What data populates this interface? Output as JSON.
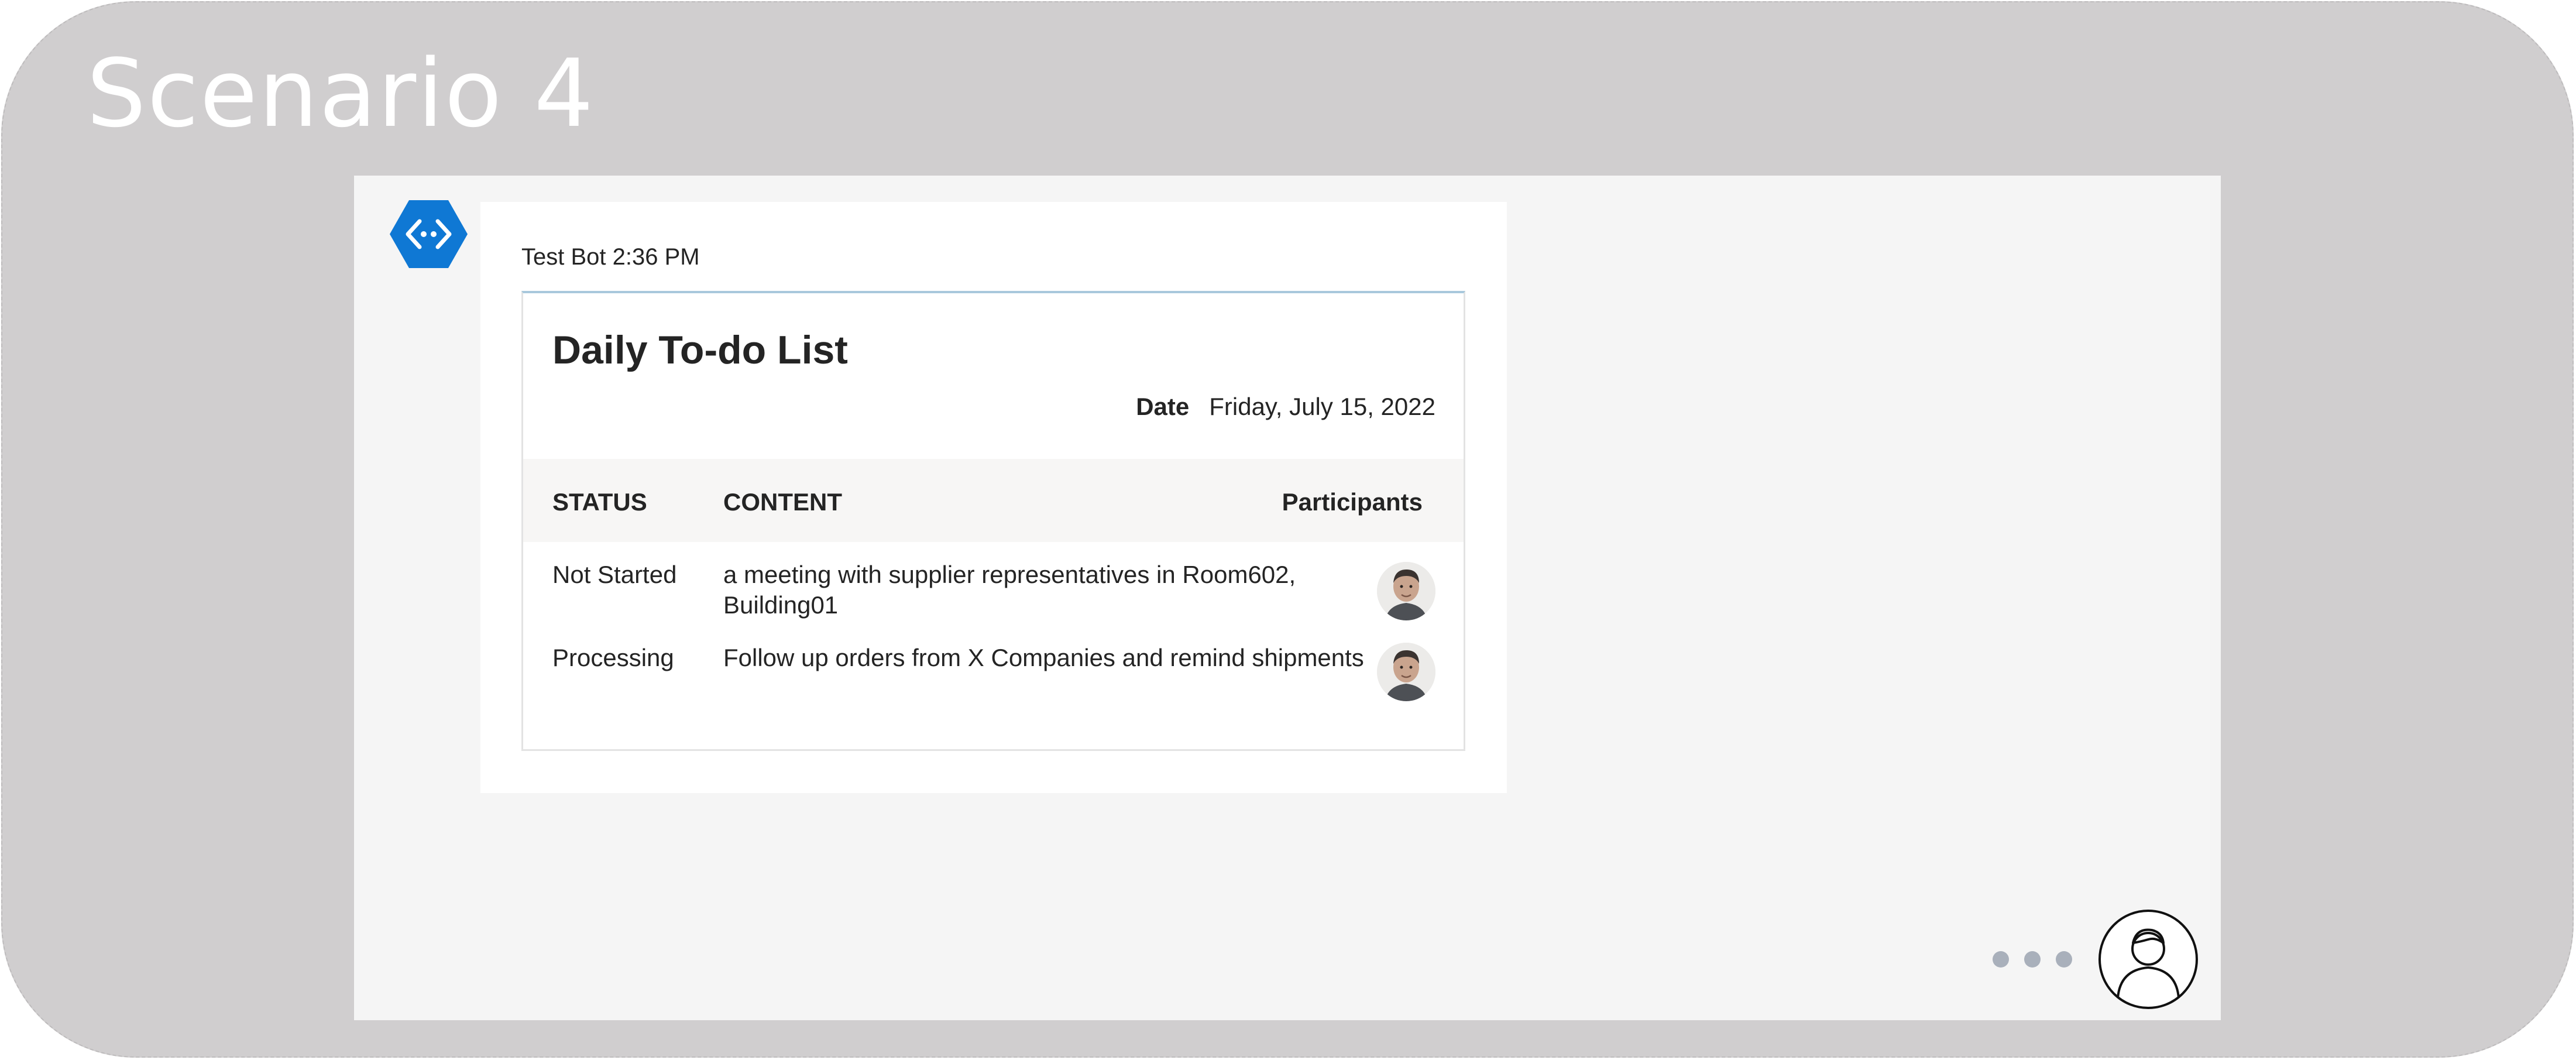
{
  "scenario": {
    "title": "Scenario 4"
  },
  "message": {
    "sender": "Test Bot",
    "time": "2:36 PM",
    "meta": "Test Bot 2:36 PM"
  },
  "card": {
    "title": "Daily To-do List",
    "date_label": "Date",
    "date_value": "Friday, July 15, 2022",
    "columns": {
      "status": "STATUS",
      "content": "CONTENT",
      "participants": "Participants"
    },
    "rows": [
      {
        "status": "Not Started",
        "content_line1": "a meeting with supplier representatives in Room602,",
        "content_line2": "Building01"
      },
      {
        "status": "Processing",
        "content_line1": "Follow up orders from X Companies and remind shipments"
      }
    ]
  },
  "colors": {
    "frame": "#d0cecf",
    "panel": "#f5f5f5",
    "bot_accent": "#0f78d4",
    "dots": "#a9b0bb"
  },
  "icons": {
    "bot": "bot-code-icon",
    "user": "user-avatar-icon",
    "participant": "participant-photo-icon"
  }
}
